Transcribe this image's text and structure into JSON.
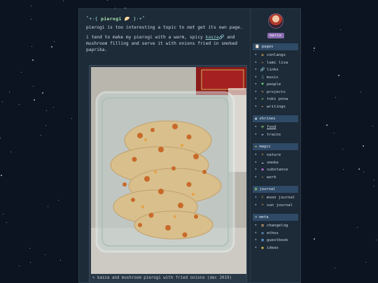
{
  "page": {
    "title_deco_left": "˚+·{",
    "title": "pierogi",
    "title_deco_right": "}·+˚",
    "intro_before_em": "pierogi is too interesting a topic to ",
    "intro_em": "not",
    "intro_after_em": " get its own page.",
    "para_before_link": "i tend to make my pierogi with a warm, spicy ",
    "para_link": "kasza",
    "para_after_link": " and mushroom filling and serve it with onions fried in smoked paprika.",
    "caption": "kasza and mushroom pierogi with fried onions (dec 2019)"
  },
  "sidebar": {
    "username": "maria",
    "sections": [
      {
        "heading": "pages",
        "icon": "clipboard-icon",
        "items": [
          {
            "label": "conlangs",
            "icon": "flower-icon"
          },
          {
            "label": "lami lisa",
            "icon": "sparkle-icon"
          },
          {
            "label": "links",
            "icon": "link-icon"
          },
          {
            "label": "music",
            "icon": "music-icon"
          },
          {
            "label": "people",
            "icon": "heart-icon"
          },
          {
            "label": "projects",
            "icon": "pencil-icon"
          },
          {
            "label": "toki pona",
            "icon": "sprout-icon"
          },
          {
            "label": "writings",
            "icon": "quill-icon"
          }
        ]
      },
      {
        "heading": "shrines",
        "icon": "bowl-icon",
        "items": [
          {
            "label": "food",
            "icon": "bread-icon",
            "active": true
          },
          {
            "label": "trains",
            "icon": "train-icon"
          }
        ]
      },
      {
        "heading": "magic",
        "icon": "star-icon",
        "items": [
          {
            "label": "nature",
            "icon": "sun-icon"
          },
          {
            "label": "smoke",
            "icon": "cloud-icon"
          },
          {
            "label": "substance",
            "icon": "orb-icon"
          },
          {
            "label": "work",
            "icon": "spark-icon"
          }
        ]
      },
      {
        "heading": "journal",
        "icon": "book-icon",
        "items": [
          {
            "label": "moon journal",
            "icon": "moon-icon"
          },
          {
            "label": "sun journal",
            "icon": "sun-icon"
          }
        ]
      },
      {
        "heading": "meta",
        "icon": "wrench-icon",
        "items": [
          {
            "label": "changelog",
            "icon": "scroll-icon"
          },
          {
            "label": "ethos",
            "icon": "globe-icon"
          },
          {
            "label": "guestbook",
            "icon": "notebook-icon"
          },
          {
            "label": "ideas",
            "icon": "bulb-icon"
          }
        ]
      }
    ]
  },
  "colors": {
    "background": "#0b1420",
    "panel": "#1d2a37",
    "section_header": "#2f4a66",
    "username_badge": "#8a6bb0",
    "accent_text": "#9fe0d6"
  }
}
